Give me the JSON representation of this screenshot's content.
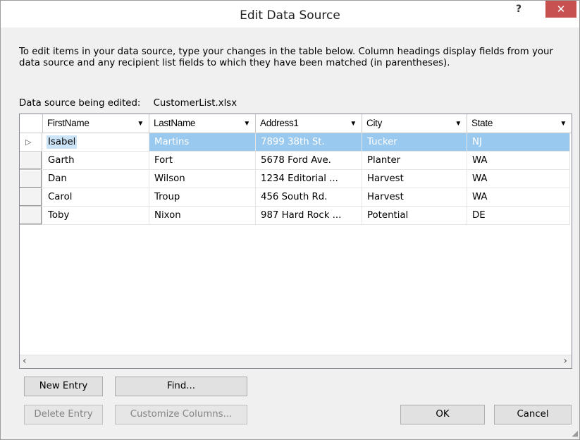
{
  "window": {
    "title": "Edit Data Source",
    "help_label": "?",
    "close_label": "✕"
  },
  "instructions": "To edit items in your data source, type your changes in the table below. Column headings display fields from your data source and any recipient list fields to which they have been matched (in parentheses).",
  "source": {
    "label": "Data source being edited:",
    "filename": "CustomerList.xlsx"
  },
  "columns": [
    {
      "label": "FirstName"
    },
    {
      "label": "LastName"
    },
    {
      "label": "Address1"
    },
    {
      "label": "City"
    },
    {
      "label": "State"
    }
  ],
  "rows": [
    {
      "first": "Isabel",
      "last": "Martins",
      "address": "7899 38th St.",
      "city": "Tucker",
      "state": "NJ",
      "selected": true
    },
    {
      "first": "Garth",
      "last": "Fort",
      "address": "5678 Ford Ave.",
      "city": "Planter",
      "state": "WA"
    },
    {
      "first": "Dan",
      "last": "Wilson",
      "address": "1234 Editorial ...",
      "city": "Harvest",
      "state": "WA"
    },
    {
      "first": "Carol",
      "last": "Troup",
      "address": "456 South Rd.",
      "city": "Harvest",
      "state": "WA"
    },
    {
      "first": "Toby",
      "last": "Nixon",
      "address": "987 Hard Rock ...",
      "city": "Potential",
      "state": "DE"
    }
  ],
  "buttons": {
    "new_entry": "New Entry",
    "find": "Find...",
    "delete_entry": "Delete Entry",
    "customize_columns": "Customize Columns...",
    "ok": "OK",
    "cancel": "Cancel"
  },
  "icons": {
    "row_pointer": "triangle-right-outline",
    "dropdown": "caret-down",
    "scroll_left": "chevron-left",
    "scroll_right": "chevron-right",
    "resize_grip": "resize-grip"
  },
  "colors": {
    "selection": "#99c9ef",
    "close_button": "#c75050"
  }
}
